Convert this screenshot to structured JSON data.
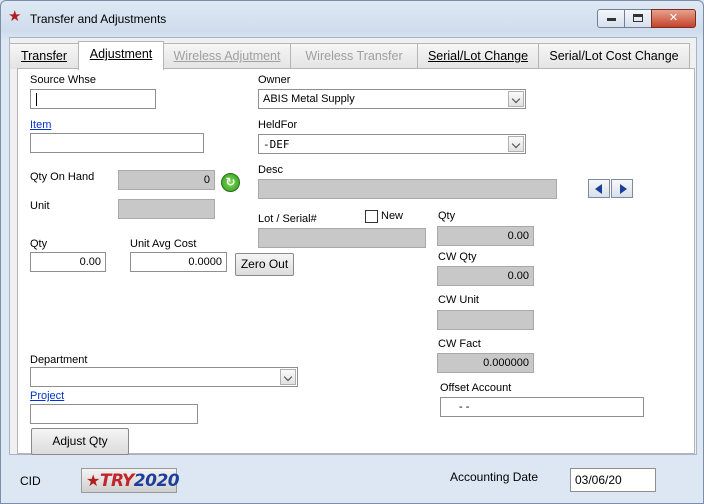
{
  "window": {
    "title": "Transfer and Adjustments",
    "controls": {
      "minimize": "minimize-icon",
      "maximize": "maximize-icon",
      "close": "close-icon"
    }
  },
  "tabs": [
    {
      "label": "Transfer",
      "state": "enabled"
    },
    {
      "label": "Adjustment",
      "state": "active"
    },
    {
      "label": "Wireless Adjutment",
      "state": "disabled"
    },
    {
      "label": "Wireless Transfer",
      "state": "disabled"
    },
    {
      "label": "Serial/Lot Change",
      "state": "enabled"
    },
    {
      "label": "Serial/Lot Cost Change",
      "state": "enabled"
    }
  ],
  "form": {
    "source_whse": {
      "label": "Source Whse",
      "value": ""
    },
    "owner": {
      "label": "Owner",
      "value": "ABIS Metal Supply"
    },
    "item": {
      "label": "Item",
      "value": ""
    },
    "held_for": {
      "label": "HeldFor",
      "value": "-DEF"
    },
    "qty_on_hand": {
      "label": "Qty On Hand",
      "value": "0"
    },
    "desc": {
      "label": "Desc",
      "value": ""
    },
    "unit": {
      "label": "Unit",
      "value": ""
    },
    "lot_serial": {
      "label": "Lot / Serial#",
      "value": ""
    },
    "new": {
      "label": "New",
      "checked": false
    },
    "qty": {
      "label": "Qty",
      "value": "0.00"
    },
    "unit_avg_cost": {
      "label": "Unit Avg Cost",
      "value": "0.0000"
    },
    "zero_out_label": "Zero Out",
    "right_qty": {
      "label": "Qty",
      "value": "0.00"
    },
    "cw_qty": {
      "label": "CW Qty",
      "value": "0.00"
    },
    "cw_unit": {
      "label": "CW Unit",
      "value": ""
    },
    "cw_fact": {
      "label": "CW Fact",
      "value": "0.000000"
    },
    "department": {
      "label": "Department",
      "value": ""
    },
    "offset_account": {
      "label": "Offset Account",
      "value": "-  -"
    },
    "project": {
      "label": "Project",
      "value": ""
    },
    "adjust_qty_label": "Adjust Qty"
  },
  "footer": {
    "cid_label": "CID",
    "logo": {
      "prefix": "TRY",
      "year": "2020"
    },
    "accounting_date": {
      "label": "Accounting Date",
      "value": "03/06/20"
    }
  },
  "colors": {
    "readonly_bg": "#c8c8c8",
    "link": "#0033cc",
    "accent_red": "#b21e1e",
    "accent_blue": "#1d3f9c"
  }
}
